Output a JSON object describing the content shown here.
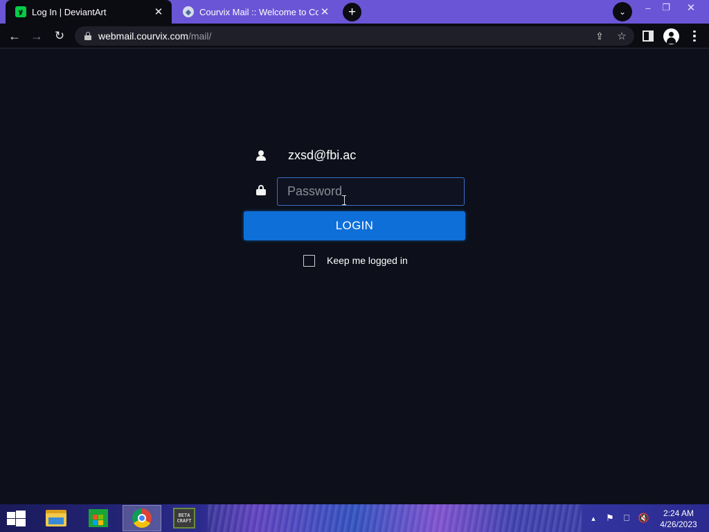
{
  "browser": {
    "tabs": [
      {
        "title": "Log In | DeviantArt",
        "favicon": "deviantart-logo",
        "active": true
      },
      {
        "title": "Courvix Mail :: Welcome to Courv",
        "favicon": "courvix-logo",
        "active": false
      }
    ],
    "address": {
      "host": "webmail.courvix.com",
      "path": "/mail/"
    }
  },
  "login": {
    "username": "zxsd@fbi.ac",
    "password_placeholder": "Password",
    "password_value": "",
    "login_label": "LOGIN",
    "keep_logged_in_label": "Keep me logged in",
    "keep_logged_in_checked": false
  },
  "taskbar": {
    "apps": [
      "start-button",
      "file-explorer",
      "microsoft-store",
      "google-chrome",
      "minecraft-launcher"
    ],
    "minecraft_icon_text": "BETA CRAFT",
    "time": "2:24 AM",
    "date": "4/26/2023"
  },
  "colors": {
    "tabstrip": "#6a55d6",
    "page_background": "#0d101a",
    "login_button": "#0e6fd8",
    "input_border": "#3b6fc8"
  }
}
